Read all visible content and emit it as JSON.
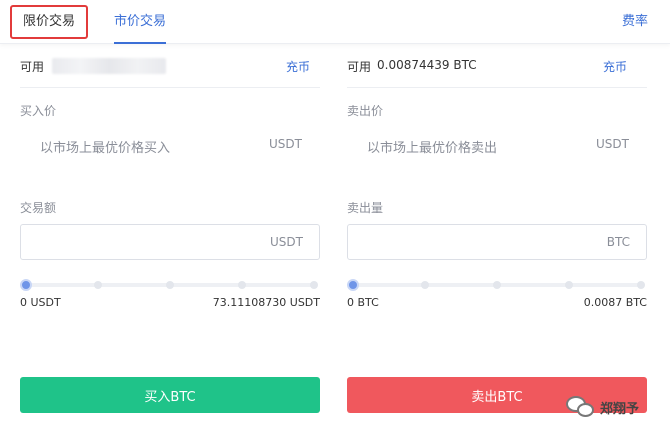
{
  "tabs": {
    "limit_label": "限价交易",
    "market_label": "市价交易",
    "fee_label": "费率"
  },
  "buy": {
    "available_label": "可用",
    "deposit_label": "充币",
    "price_label": "买入价",
    "price_text": "以市场上最优价格买入",
    "price_unit": "USDT",
    "amount_label": "交易额",
    "amount_value": "",
    "amount_unit": "USDT",
    "slider_percent": 0,
    "range_min": "0 USDT",
    "range_max": "73.11108730 USDT",
    "button_label": "买入BTC",
    "button_color": "#1fc389"
  },
  "sell": {
    "available_label": "可用",
    "available_value": "0.00874439 BTC",
    "deposit_label": "充币",
    "price_label": "卖出价",
    "price_text": "以市场上最优价格卖出",
    "price_unit": "USDT",
    "amount_label": "卖出量",
    "amount_value": "",
    "amount_unit": "BTC",
    "slider_percent": 0,
    "range_min": "0 BTC",
    "range_max": "0.0087 BTC",
    "button_label": "卖出BTC",
    "button_color": "#f0585d"
  },
  "watermark": {
    "text": "郑翔予",
    "icon": "wechat-icon"
  },
  "colors": {
    "accent": "#3b6fd6",
    "highlight_box": "#e23b3b"
  }
}
